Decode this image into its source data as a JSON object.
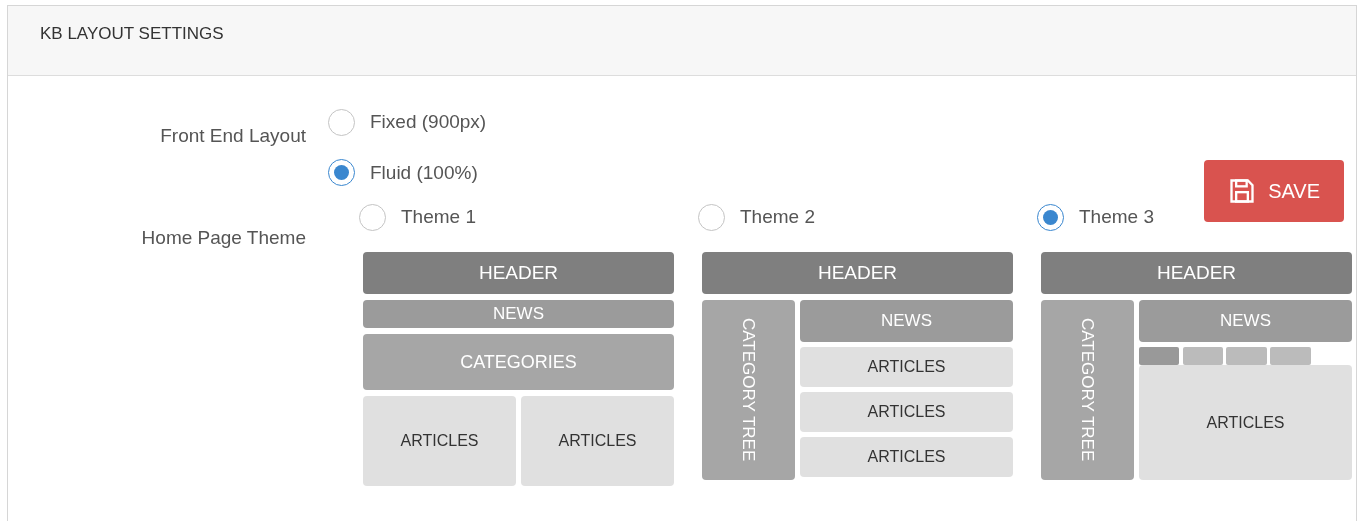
{
  "panel": {
    "title": "KB LAYOUT SETTINGS"
  },
  "front_end_layout": {
    "label": "Front End Layout",
    "options": [
      {
        "label": "Fixed (900px)",
        "selected": false
      },
      {
        "label": "Fluid (100%)",
        "selected": true
      }
    ]
  },
  "save_button": {
    "label": "SAVE"
  },
  "home_page_theme": {
    "label": "Home Page Theme",
    "themes": [
      {
        "label": "Theme 1",
        "selected": false,
        "kind": "stacked",
        "header": "HEADER",
        "news": "NEWS",
        "categories": "CATEGORIES",
        "articles": [
          "ARTICLES",
          "ARTICLES"
        ]
      },
      {
        "label": "Theme 2",
        "selected": false,
        "kind": "sidebar",
        "header": "HEADER",
        "sidebar": "CATEGORY TREE",
        "news": "NEWS",
        "articles": [
          "ARTICLES",
          "ARTICLES",
          "ARTICLES"
        ]
      },
      {
        "label": "Theme 3",
        "selected": true,
        "kind": "tabbed",
        "header": "HEADER",
        "sidebar": "CATEGORY TREE",
        "news": "NEWS",
        "articles": [
          "ARTICLES"
        ]
      }
    ]
  }
}
